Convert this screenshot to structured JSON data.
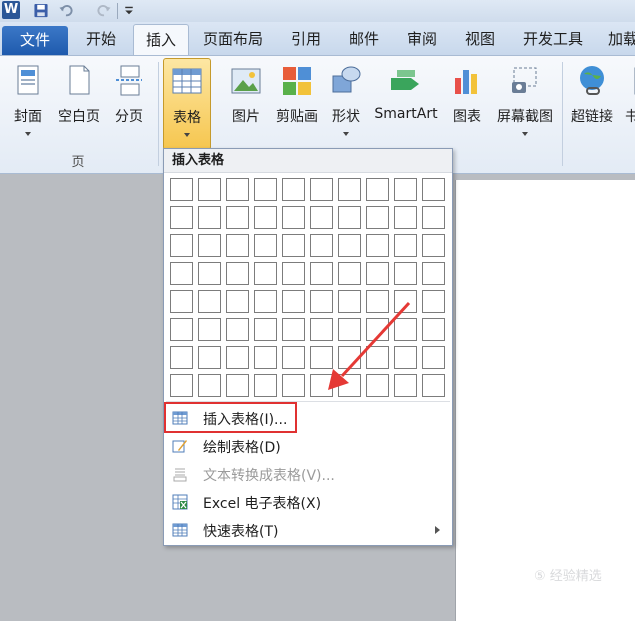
{
  "quick_access": {
    "app_logo": "W",
    "undo_icon": "undo-icon",
    "redo_icon": "redo-icon",
    "save_icon": "save-icon"
  },
  "tabs": [
    {
      "label": "文件"
    },
    {
      "label": "开始"
    },
    {
      "label": "插入"
    },
    {
      "label": "页面布局"
    },
    {
      "label": "引用"
    },
    {
      "label": "邮件"
    },
    {
      "label": "审阅"
    },
    {
      "label": "视图"
    },
    {
      "label": "开发工具"
    },
    {
      "label": "加载"
    }
  ],
  "ribbon": {
    "buttons": [
      {
        "label": "封面",
        "icon": "cover-page-icon"
      },
      {
        "label": "空白页",
        "icon": "blank-page-icon"
      },
      {
        "label": "分页",
        "icon": "page-break-icon"
      },
      {
        "label": "表格",
        "icon": "table-icon"
      },
      {
        "label": "图片",
        "icon": "picture-icon"
      },
      {
        "label": "剪贴画",
        "icon": "clip-art-icon"
      },
      {
        "label": "形状",
        "icon": "shapes-icon"
      },
      {
        "label": "SmartArt",
        "icon": "smartart-icon"
      },
      {
        "label": "图表",
        "icon": "chart-icon"
      },
      {
        "label": "屏幕截图",
        "icon": "screenshot-icon"
      },
      {
        "label": "超链接",
        "icon": "hyperlink-icon"
      },
      {
        "label": "书",
        "icon": "bookmark-icon"
      }
    ],
    "group_pages_label": "页"
  },
  "dropdown": {
    "title": "插入表格",
    "grid": {
      "cols": 10,
      "rows": 8
    },
    "items": [
      {
        "label": "插入表格(I)...",
        "icon": "insert-table-icon",
        "disabled": false
      },
      {
        "label": "绘制表格(D)",
        "icon": "draw-table-icon",
        "disabled": false
      },
      {
        "label": "文本转换成表格(V)...",
        "icon": "convert-text-table-icon",
        "disabled": true
      },
      {
        "label": "Excel 电子表格(X)",
        "icon": "excel-sheet-icon",
        "disabled": false
      },
      {
        "label": "快速表格(T)",
        "icon": "quick-tables-icon",
        "disabled": false
      }
    ]
  },
  "colors": {
    "accent": "#2b5797",
    "highlight_box": "#e03131",
    "pressed": "#f6c64f"
  }
}
